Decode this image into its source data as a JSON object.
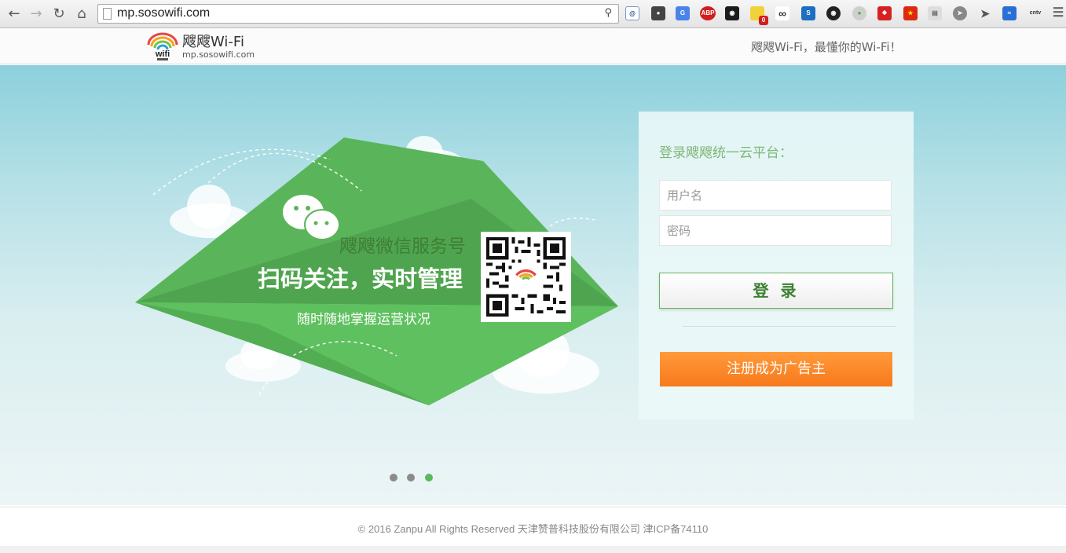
{
  "browser": {
    "url": "mp.sosowifi.com",
    "abp_label": "ABP",
    "badge_count": "0",
    "cntv_label": "cntv",
    "icons": [
      "back-icon",
      "forward-icon",
      "reload-icon",
      "home-icon",
      "page-icon",
      "key-icon"
    ]
  },
  "header": {
    "brand": "飕飕Wi-Fi",
    "domain": "mp.sosowifi.com",
    "logo_text": "wifi",
    "slogan": "飕飕Wi-Fi，最懂你的Wi-Fi！"
  },
  "promo": {
    "title": "飕飕微信服务号",
    "headline": "扫码关注，实时管理",
    "subline": "随时随地掌握运营状况"
  },
  "login": {
    "title": "登录飕飕统一云平台：",
    "username_placeholder": "用户名",
    "password_placeholder": "密码",
    "login_label": "登 录",
    "register_label": "注册成为广告主"
  },
  "carousel": {
    "slides": 3,
    "active": 3
  },
  "footer": {
    "copyright": "© 2016 Zanpu All Rights Reserved 天津赞普科技股份有限公司 津ICP备74110"
  },
  "colors": {
    "green": "#5cb85c",
    "orange": "#f7791c",
    "sky": "#8cd0dc",
    "title_green": "#7fb776"
  }
}
